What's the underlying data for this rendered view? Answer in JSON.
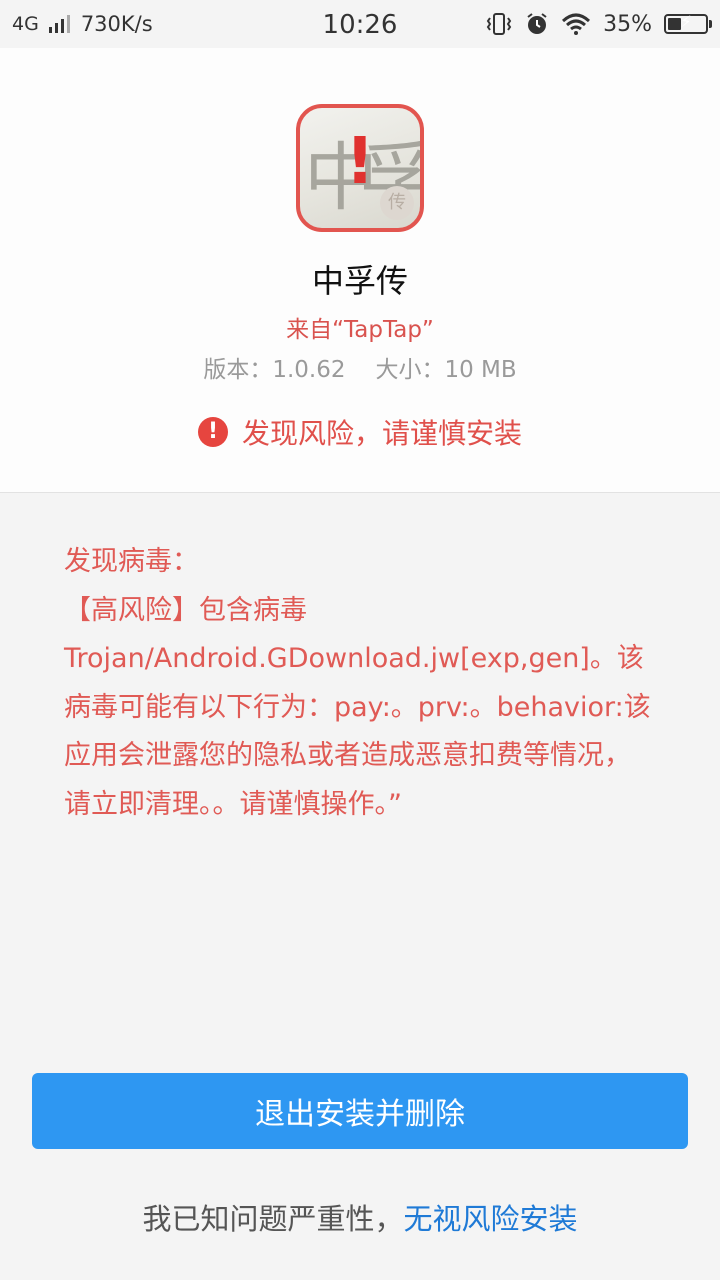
{
  "status_bar": {
    "network": "4G",
    "speed": "730K/s",
    "time": "10:26",
    "battery_percent": "35%",
    "battery_level": 0.35,
    "icons": [
      "signal-icon",
      "vibrate-icon",
      "alarm-icon",
      "wifi-icon",
      "battery-icon"
    ]
  },
  "app": {
    "name": "中孚传",
    "source": "来自“TapTap”",
    "version_label": "版本：",
    "version": "1.0.62",
    "size_label": "大小：",
    "size": "10 MB",
    "icon_glyph": "中孚",
    "icon_seal": "传"
  },
  "risk": {
    "warning": "发现风险，请谨慎安装",
    "icon": "alert-circle-icon"
  },
  "virus": {
    "heading": "发现病毒：",
    "detail": "【高风险】包含病毒Trojan/Android.GDownload.jw[exp,gen]。该病毒可能有以下行为：pay:。prv:。behavior:该应用会泄露您的隐私或者造成恶意扣费等情况，请立即清理。。请谨慎操作。”"
  },
  "actions": {
    "exit_delete_label": "退出安装并删除",
    "ignore_prefix": "我已知问题严重性，",
    "ignore_link": "无视风险安装"
  },
  "colors": {
    "accent_blue": "#2e97f2",
    "link_blue": "#1f7ad6",
    "danger_red": "#e0504b"
  }
}
